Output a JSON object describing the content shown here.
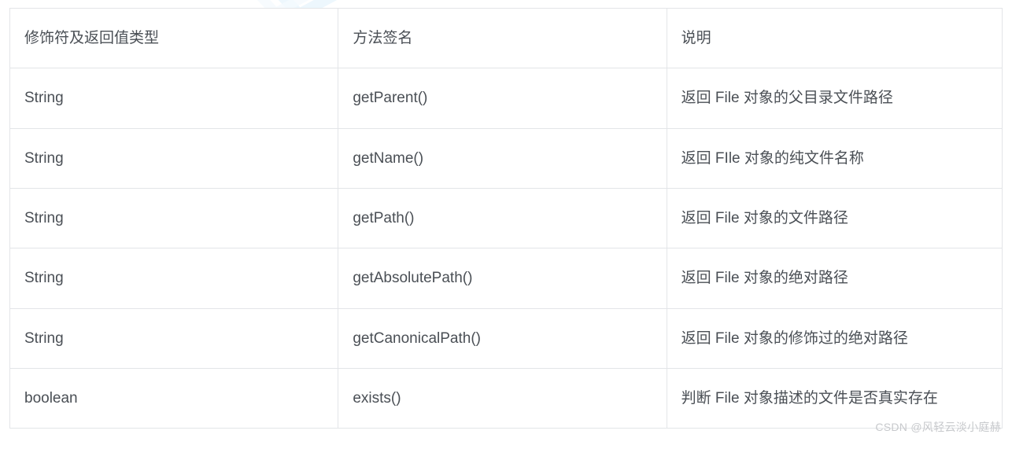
{
  "table": {
    "headers": [
      "修饰符及返回值类型",
      "方法签名",
      "说明"
    ],
    "rows": [
      {
        "type": "String",
        "method": "getParent()",
        "description": "返回 File 对象的父目录文件路径"
      },
      {
        "type": "String",
        "method": "getName()",
        "description": "返回 FIle 对象的纯文件名称"
      },
      {
        "type": "String",
        "method": "getPath()",
        "description": "返回 File 对象的文件路径"
      },
      {
        "type": "String",
        "method": "getAbsolutePath()",
        "description": "返回 File 对象的绝对路径"
      },
      {
        "type": "String",
        "method": "getCanonicalPath()",
        "description": "返回 File 对象的修饰过的绝对路径"
      },
      {
        "type": "boolean",
        "method": "exists()",
        "description": "判断 File 对象描述的文件是否真实存在"
      }
    ]
  },
  "attribution": "CSDN @风轻云淡小庭赫"
}
